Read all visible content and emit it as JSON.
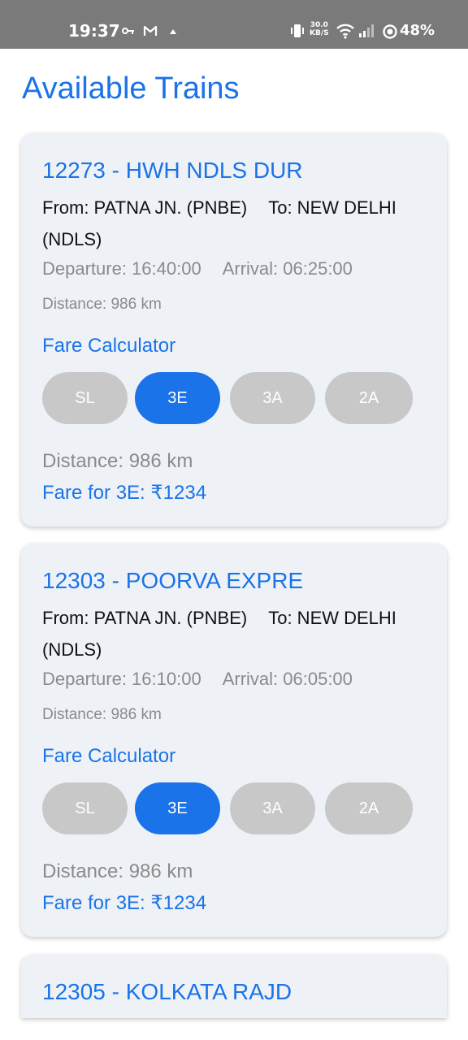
{
  "status": {
    "time": "19:37",
    "speed_value": "30.0",
    "speed_unit": "KB/S",
    "battery": "48%"
  },
  "page": {
    "title": "Available Trains"
  },
  "trains": [
    {
      "title": "12273 - HWH NDLS DUR",
      "from": "From: PATNA JN. (PNBE)",
      "to": "To: NEW DELHI (NDLS)",
      "departure": "Departure: 16:40:00",
      "arrival": "Arrival: 06:25:00",
      "distance": "Distance: 986 km",
      "fare_calc_label": "Fare Calculator",
      "classes": [
        "SL",
        "3E",
        "3A",
        "2A"
      ],
      "selected_class": "3E",
      "result_distance": "Distance: 986 km",
      "fare": "Fare for 3E: ₹1234"
    },
    {
      "title": "12303 - POORVA EXPRE",
      "from": "From: PATNA JN. (PNBE)",
      "to": "To: NEW DELHI (NDLS)",
      "departure": "Departure: 16:10:00",
      "arrival": "Arrival: 06:05:00",
      "distance": "Distance: 986 km",
      "fare_calc_label": "Fare Calculator",
      "classes": [
        "SL",
        "3E",
        "3A",
        "2A"
      ],
      "selected_class": "3E",
      "result_distance": "Distance: 986 km",
      "fare": "Fare for 3E: ₹1234"
    },
    {
      "title": "12305 - KOLKATA RAJD"
    }
  ]
}
